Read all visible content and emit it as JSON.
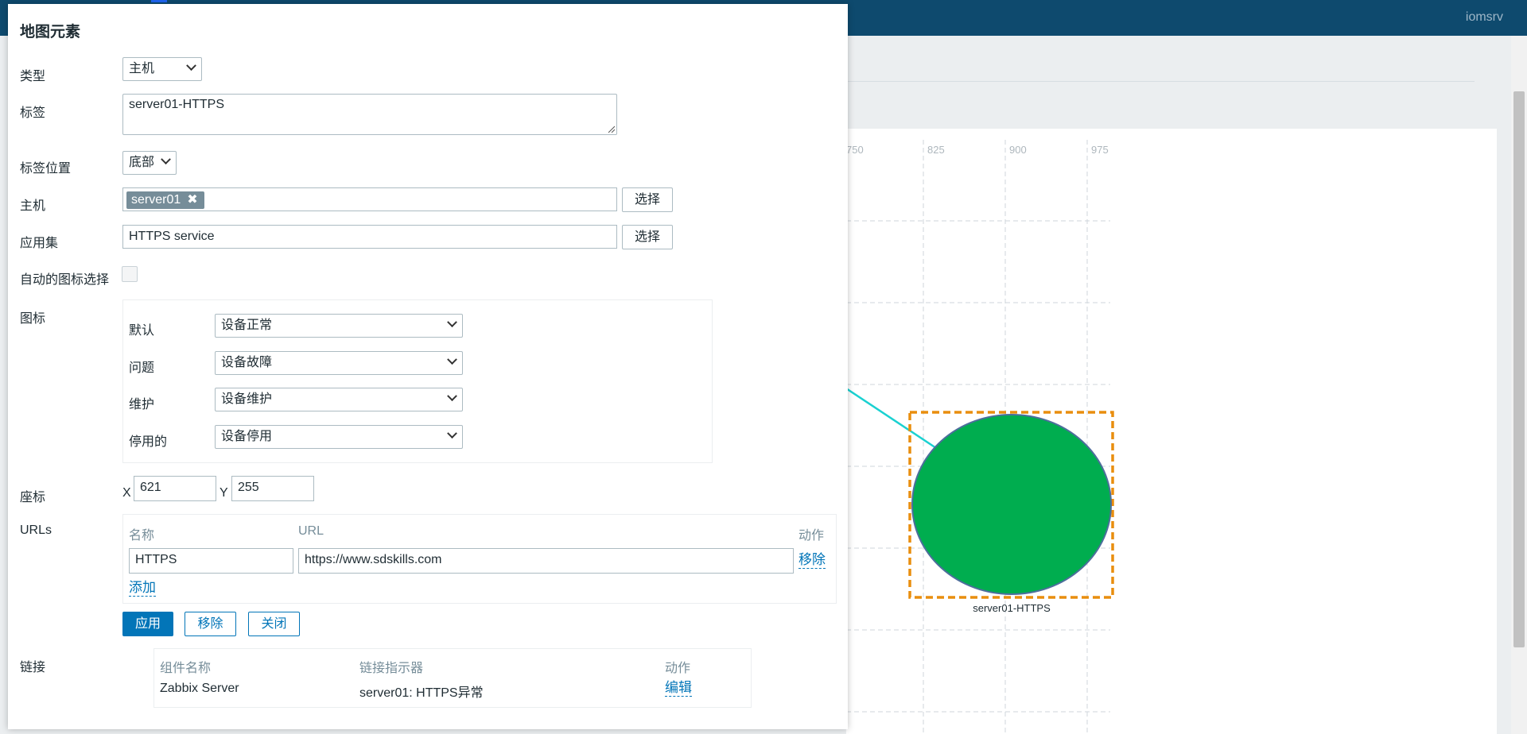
{
  "app": {
    "username": "iomsrv"
  },
  "map": {
    "ruler_labels": [
      "750",
      "825",
      "900",
      "975"
    ],
    "element_label": "server01-HTTPS",
    "element_color": "#00ad4f",
    "link_color": "#1ad1d1",
    "selection_color": "#e98e0e"
  },
  "dialog": {
    "title": "地图元素",
    "type": {
      "label": "类型",
      "value": "主机"
    },
    "label_field": {
      "label": "标签",
      "value": "server01-HTTPS"
    },
    "label_position": {
      "label": "标签位置",
      "value": "底部"
    },
    "host": {
      "label": "主机",
      "chip": "server01",
      "chip_remove": "✖",
      "select_button": "选择"
    },
    "application": {
      "label": "应用集",
      "value": "HTTPS service",
      "select_button": "选择"
    },
    "auto_icon": {
      "label": "自动的图标选择"
    },
    "icons": {
      "label": "图标",
      "default": {
        "label": "默认",
        "value": "设备正常"
      },
      "problem": {
        "label": "问题",
        "value": "设备故障"
      },
      "maintenance": {
        "label": "维护",
        "value": "设备维护"
      },
      "disabled": {
        "label": "停用的",
        "value": "设备停用"
      }
    },
    "coordinates": {
      "label": "座标",
      "x_label": "X",
      "x_value": "621",
      "y_label": "Y",
      "y_value": "255"
    },
    "urls": {
      "label": "URLs",
      "col_name": "名称",
      "col_url": "URL",
      "col_action": "动作",
      "rows": [
        {
          "name": "HTTPS",
          "url": "https://www.sdskills.com",
          "action": "移除"
        }
      ],
      "add": "添加"
    },
    "buttons": {
      "apply": "应用",
      "remove": "移除",
      "close": "关闭"
    },
    "links": {
      "label": "链接",
      "col_element": "组件名称",
      "col_indicator": "链接指示器",
      "col_action": "动作",
      "rows": [
        {
          "element": "Zabbix Server",
          "indicator": "server01: HTTPS异常",
          "action": "编辑"
        }
      ]
    }
  }
}
